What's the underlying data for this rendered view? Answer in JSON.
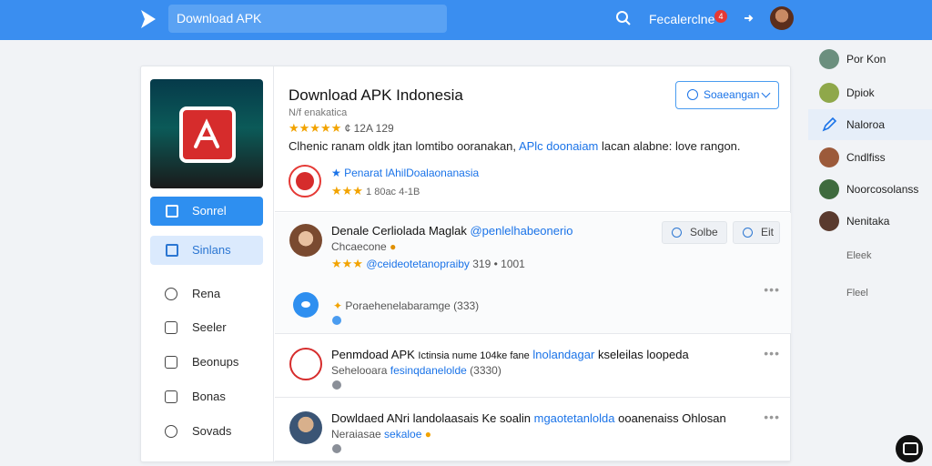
{
  "topbar": {
    "search_value": "Download APK",
    "user_label": "Fecalerclne",
    "notif_count": "4"
  },
  "app": {
    "title": "Download APK Indonesia",
    "subtitle": "N/f enakatica",
    "rating_text": "¢ 12A 129",
    "description_plain": "Clhenic ranam oldk jtan lomtibo ooranakan,",
    "description_link": "APlc doonaiam",
    "description_rest": "lacan alabne: love rangon.",
    "developer_link": "Penarat lAhilDoalaonanasia",
    "developer_meta": "1 80ac 4-1B",
    "follow_button": "Soaeangan"
  },
  "left_panel": {
    "primary_button": "Sonrel",
    "secondary_button": "Sinlans",
    "items": [
      {
        "label": "Rena",
        "icon": "compass-icon"
      },
      {
        "label": "Seeler",
        "icon": "window-icon"
      },
      {
        "label": "Beonups",
        "icon": "grid-icon"
      },
      {
        "label": "Bonas",
        "icon": "box-icon"
      },
      {
        "label": "Sovads",
        "icon": "clock-icon"
      }
    ]
  },
  "posts": [
    {
      "name": "Denale Cerliolada Maglak",
      "tag": "@penlelhabeonerio",
      "line2": "Chcaecone",
      "line3_tag": "@ceideotetanopraiby",
      "line3_meta": "319 • 1001",
      "line4": "Poraehenelabaramge (333)",
      "save_label": "Solbe",
      "edit_label": "Eit"
    },
    {
      "name": "Penmdoad APK",
      "name_mid": "Ictinsia nume 104ke fane",
      "name_tag": "lnolandagar",
      "name_rest": "kseleilas loopeda",
      "line2": "Sehelooara",
      "line2_tag": "fesinqdanelolde",
      "line2_meta": "(3330)"
    },
    {
      "name": "Dowldaed ANri landolaasais",
      "name_mid": "Ke soalin",
      "name_tag": "mgaotetanlolda",
      "name_rest": "ooanenaiss Ohlosan",
      "line2": "Neraiasae",
      "line2_tag": "sekaloe"
    }
  ],
  "right_sidebar": {
    "people": [
      {
        "label": "Por Kon",
        "color": "#6b8f7e"
      },
      {
        "label": "Dpiok",
        "color": "#8fa84a"
      },
      {
        "label": "Naloroa",
        "color": "#ffffff"
      },
      {
        "label": "Cndlfiss",
        "color": "#9c5a3a"
      },
      {
        "label": "Noorcosolanss",
        "color": "#3f6b3e"
      },
      {
        "label": "Nenitaka",
        "color": "#5a3a2e"
      }
    ],
    "plain_items": [
      "Eleek",
      "Fleel"
    ]
  },
  "colors": {
    "topbar": "#3a8ef0",
    "accent": "#2e8ff0",
    "link": "#1a73e8",
    "star": "#f2a300"
  }
}
